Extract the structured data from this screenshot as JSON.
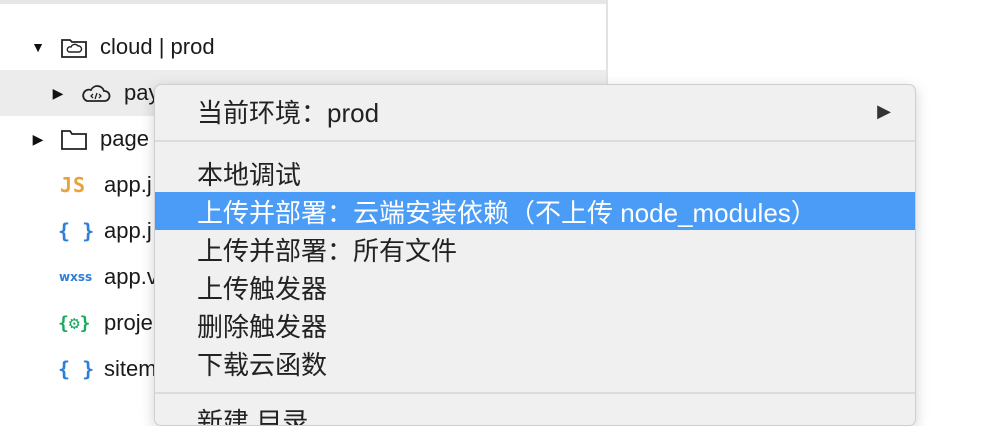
{
  "tree": {
    "items": [
      {
        "label": "cloud | prod",
        "icon": "cloud-folder-icon",
        "expanded": true
      },
      {
        "label": "pay",
        "icon": "cloud-function-icon",
        "expanded": false
      },
      {
        "label": "page",
        "icon": "folder-icon",
        "expanded": false
      },
      {
        "label": "app.j",
        "icon": "js-file-icon",
        "icon_text": "JS"
      },
      {
        "label": "app.j",
        "icon": "json-file-icon",
        "icon_text": "{ }"
      },
      {
        "label": "app.v",
        "icon": "wxss-file-icon",
        "icon_text": "wxss"
      },
      {
        "label": "proje",
        "icon": "project-config-icon",
        "icon_text": "{⚙}"
      },
      {
        "label": "sitem",
        "icon": "json-file-icon",
        "icon_text": "{ }"
      }
    ]
  },
  "context_menu": {
    "items": [
      {
        "label": "当前环境：prod",
        "has_submenu": true
      },
      {
        "label": "本地调试"
      },
      {
        "label": "上传并部署：云端安装依赖（不上传 node_modules）",
        "highlighted": true
      },
      {
        "label": "上传并部署：所有文件"
      },
      {
        "label": "上传触发器"
      },
      {
        "label": "删除触发器"
      },
      {
        "label": "下载云函数"
      },
      {
        "label": "新建 目录"
      }
    ]
  },
  "colors": {
    "highlight": "#4a9cf6",
    "menu_bg": "#f0f0f0",
    "js_icon": "#e8a33b",
    "json_icon": "#2f7fd8",
    "config_icon": "#1aaa5f"
  }
}
